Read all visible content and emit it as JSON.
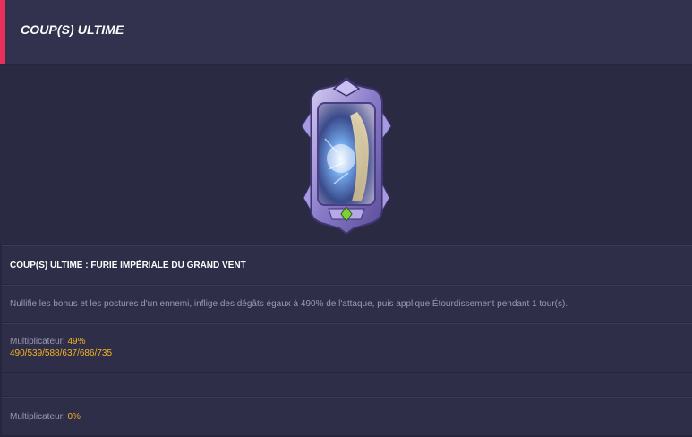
{
  "header": {
    "title": "COUP(S) ULTIME"
  },
  "skill": {
    "name": "COUP(S) ULTIME : FURIE IMPÉRIALE DU GRAND VENT",
    "description": "Nullifie les bonus et les postures d'un ennemi, inflige des dégâts égaux à 490% de l'attaque, puis applique Étourdissement pendant 1 tour(s)."
  },
  "multiplier_1": {
    "label": "Multiplicateur:",
    "value": "49%",
    "levels": "490/539/588/637/686/735"
  },
  "multiplier_2": {
    "label": "Multiplicateur:",
    "value": "0%"
  },
  "colors": {
    "accent": "#e8315a",
    "highlight": "#f5b324",
    "frame": "#9d8fd6"
  },
  "icons": {
    "card_gem": "green-gem-icon"
  }
}
